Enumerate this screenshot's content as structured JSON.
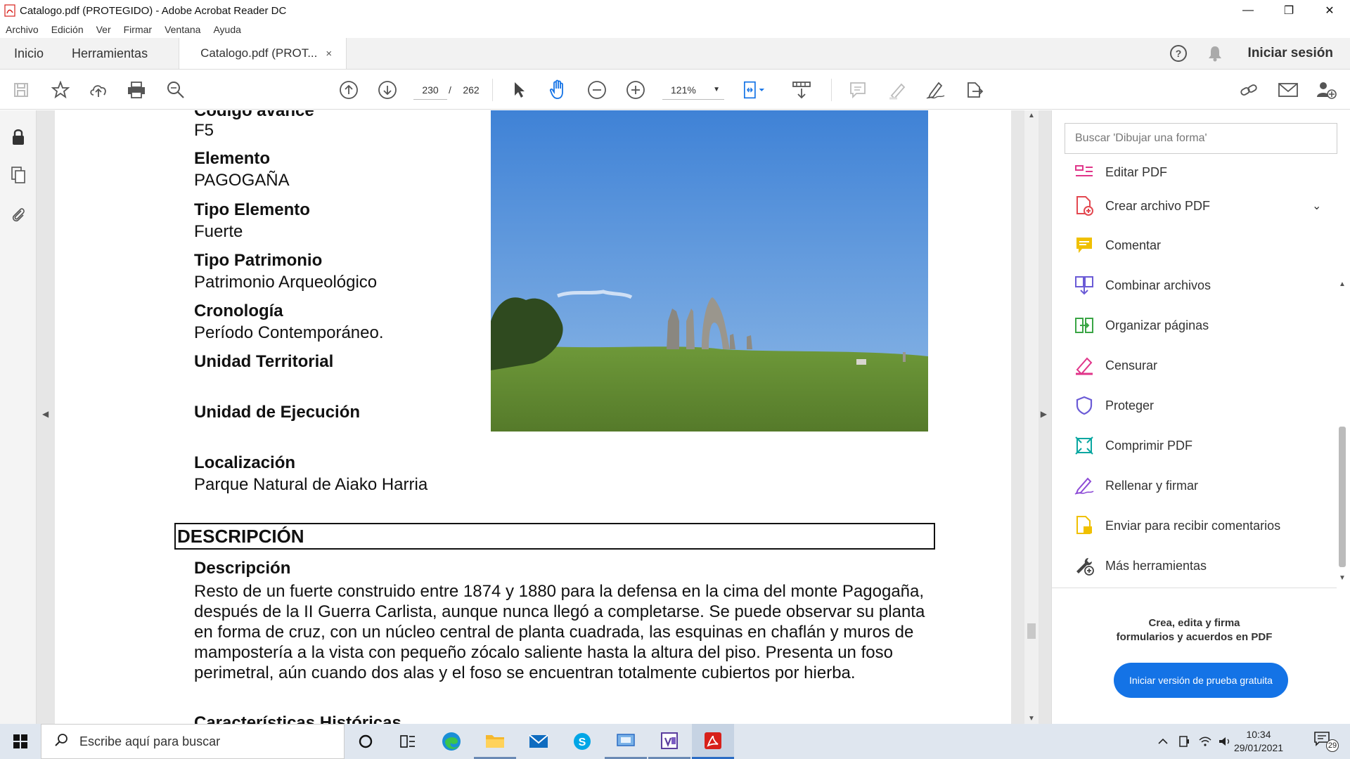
{
  "window": {
    "title": "Catalogo.pdf (PROTEGIDO) - Adobe Acrobat Reader DC",
    "controls": [
      "—",
      "❐",
      "✕"
    ]
  },
  "menu": [
    "Archivo",
    "Edición",
    "Ver",
    "Firmar",
    "Ventana",
    "Ayuda"
  ],
  "tabs": {
    "home": "Inicio",
    "tools": "Herramientas",
    "doc": "Catalogo.pdf (PROT...",
    "close": "×",
    "signin": "Iniciar sesión"
  },
  "toolbar": {
    "page_current": "230",
    "page_sep": "/",
    "page_total": "262",
    "zoom": "121%"
  },
  "document": {
    "fields": [
      {
        "label": "Código avance",
        "value": "F5"
      },
      {
        "label": "Elemento",
        "value": "PAGOGAÑA"
      },
      {
        "label": "Tipo Elemento",
        "value": "Fuerte"
      },
      {
        "label": "Tipo Patrimonio",
        "value": "Patrimonio Arqueológico"
      },
      {
        "label": "Cronología",
        "value": "Período Contemporáneo."
      },
      {
        "label": "Unidad Territorial",
        "value": ""
      },
      {
        "label": "Unidad de Ejecución",
        "value": ""
      },
      {
        "label": "Localización",
        "value": "Parque Natural de Aiako Harria"
      }
    ],
    "section_heading": "DESCRIPCIÓN",
    "description_label": "Descripción",
    "description_text": "Resto de un fuerte construido entre 1874 y 1880 para la defensa en la cima del monte Pagogaña, después de la II Guerra Carlista, aunque nunca llegó a completarse. Se puede observar su planta en forma de cruz, con un núcleo central de planta cuadrada, las esquinas en chaflán y muros de mampostería a la vista con pequeño zócalo saliente hasta la altura del piso. Presenta un foso perimetral, aún cuando dos alas y el foso se encuentran totalmente cubiertos por hierba.",
    "next_heading": "Características Históricas"
  },
  "right_panel": {
    "search_placeholder": "Buscar 'Dibujar una forma'",
    "tools": [
      {
        "label": "Editar PDF",
        "icon": "edit-pdf-icon",
        "color": "#e0368a"
      },
      {
        "label": "Crear archivo PDF",
        "icon": "create-pdf-icon",
        "color": "#e34850"
      },
      {
        "label": "Comentar",
        "icon": "comment-icon",
        "color": "#f0c000"
      },
      {
        "label": "Combinar archivos",
        "icon": "combine-files-icon",
        "color": "#6b5bd6"
      },
      {
        "label": "Organizar páginas",
        "icon": "organize-pages-icon",
        "color": "#3aa545"
      },
      {
        "label": "Censurar",
        "icon": "redact-icon",
        "color": "#e0368a"
      },
      {
        "label": "Proteger",
        "icon": "protect-icon",
        "color": "#6b5bd6"
      },
      {
        "label": "Comprimir PDF",
        "icon": "compress-pdf-icon",
        "color": "#0aa7a1"
      },
      {
        "label": "Rellenar y firmar",
        "icon": "fill-sign-icon",
        "color": "#8d4bd6"
      },
      {
        "label": "Enviar para recibir comentarios",
        "icon": "send-review-icon",
        "color": "#f0c000"
      },
      {
        "label": "Más herramientas",
        "icon": "more-tools-icon",
        "color": "#444444"
      }
    ],
    "promo_line1": "Crea, edita y firma",
    "promo_line2": "formularios y acuerdos en PDF",
    "trial_button": "Iniciar versión de prueba gratuita"
  },
  "taskbar": {
    "search_placeholder": "Escribe aquí para buscar",
    "time": "10:34",
    "date": "29/01/2021",
    "notification_count": "29"
  },
  "colors": {
    "accent": "#1473e6",
    "acrobat_red": "#d7201a"
  }
}
